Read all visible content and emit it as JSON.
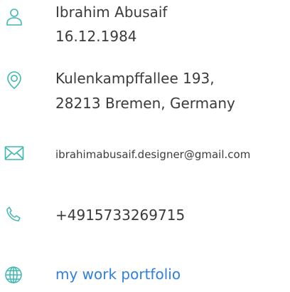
{
  "contact": {
    "accent_color": "#3fb8b0",
    "link_color": "#2f7fdc",
    "name": "Ibrahim Abusaif",
    "birthdate": "16.12.1984",
    "address_line1": "Kulenkampffallee 193,",
    "address_line2": "28213 Bremen, Germany",
    "email": "ibrahimabusaif.designer@gmail.com",
    "phone": "+4915733269715",
    "portfolio_link": "my work portfolio",
    "icons": [
      "person-icon",
      "location-pin-icon",
      "envelope-icon",
      "phone-icon",
      "globe-icon"
    ]
  }
}
